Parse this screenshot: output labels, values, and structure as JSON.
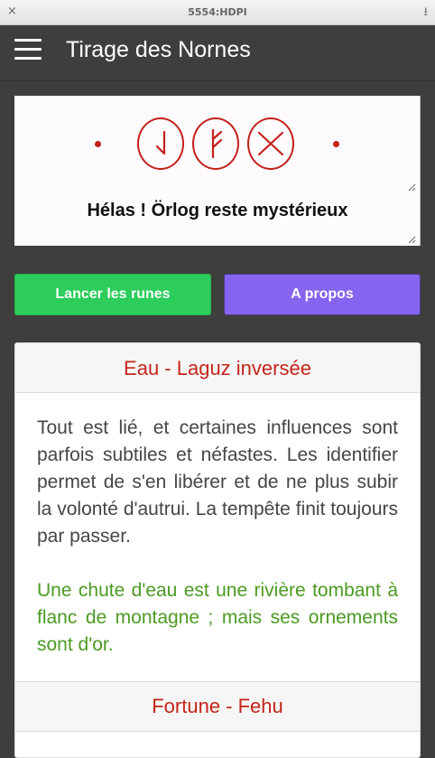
{
  "window": {
    "title": "5554:HDPI",
    "close_glyph": "×",
    "download_glyph": "⭳"
  },
  "appbar": {
    "title": "Tirage des Nornes",
    "menu_icon": "hamburger-menu-icon"
  },
  "runes": {
    "symbols": [
      "laguz-inverted-rune",
      "fehu-rune",
      "gebo-rune"
    ],
    "caption": "Hélas ! Örlog reste mystérieux",
    "accent": "#c4201a"
  },
  "buttons": {
    "throw_label": "Lancer les runes",
    "about_label": "A propos",
    "throw_color": "#2ccd5b",
    "about_color": "#8564ef"
  },
  "card": {
    "title": "Eau - Laguz inversée",
    "text": "Tout est lié, et certaines influences sont parfois subtiles et néfastes. Les identifier permet de s'en libérer et de ne plus subir la volonté d'autrui. La tempête finit toujours par passer.",
    "quote": "Une chute d'eau est une rivière tombant à flanc de montagne ; mais ses ornements sont d'or.",
    "next_title": "Fortune - Fehu",
    "title_color": "#c4251b",
    "quote_color": "#4c9a23"
  }
}
